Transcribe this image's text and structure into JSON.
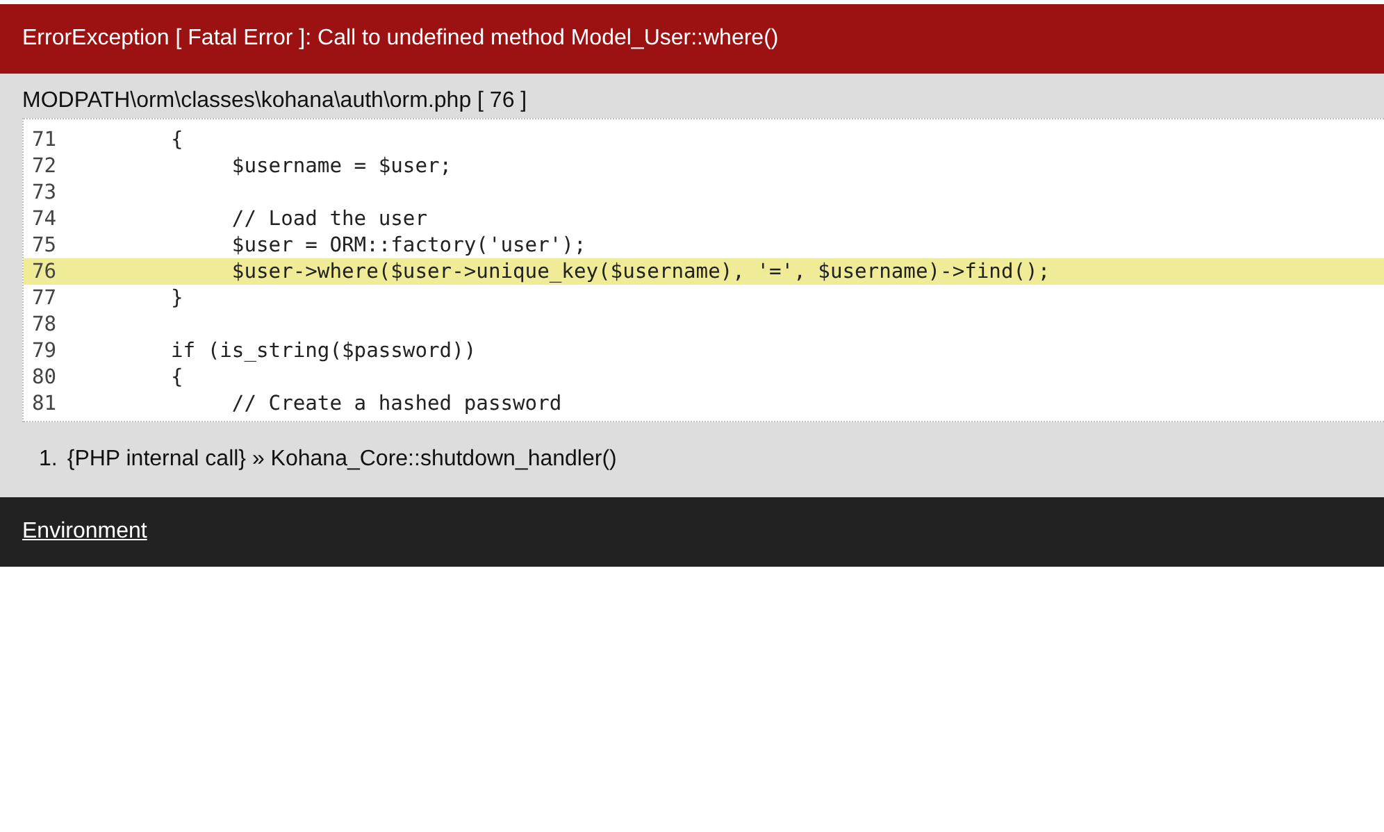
{
  "error_header": {
    "title": "ErrorException [ Fatal Error ]: Call to undefined method Model_User::where()"
  },
  "source": {
    "file": "MODPATH\\orm\\classes\\kohana\\auth\\orm.php [ 76 ]",
    "lines": [
      {
        "number": "71",
        "code": "{",
        "highlighted": false
      },
      {
        "number": "72",
        "code": "     $username = $user;",
        "highlighted": false
      },
      {
        "number": "73",
        "highlighted": false
      },
      {
        "number": "74",
        "code": "     // Load the user",
        "highlighted": false
      },
      {
        "number": "75",
        "code": "     $user = ORM::factory('user');",
        "highlighted": false
      },
      {
        "number": "76",
        "code": "     $user->where($user->unique_key($username), '=', $username)->find();",
        "highlighted": true
      },
      {
        "number": "77",
        "code": "}",
        "highlighted": false
      },
      {
        "number": "78",
        "highlighted": false
      },
      {
        "number": "79",
        "code": "if (is_string($password))",
        "highlighted": false
      },
      {
        "number": "80",
        "code": "{",
        "highlighted": false
      },
      {
        "number": "81",
        "code": "     // Create a hashed password",
        "highlighted": false
      }
    ]
  },
  "trace": [
    {
      "marker": "1.",
      "text": "{PHP internal call} » Kohana_Core::shutdown_handler()"
    }
  ],
  "footer": {
    "link": "Environment"
  }
}
